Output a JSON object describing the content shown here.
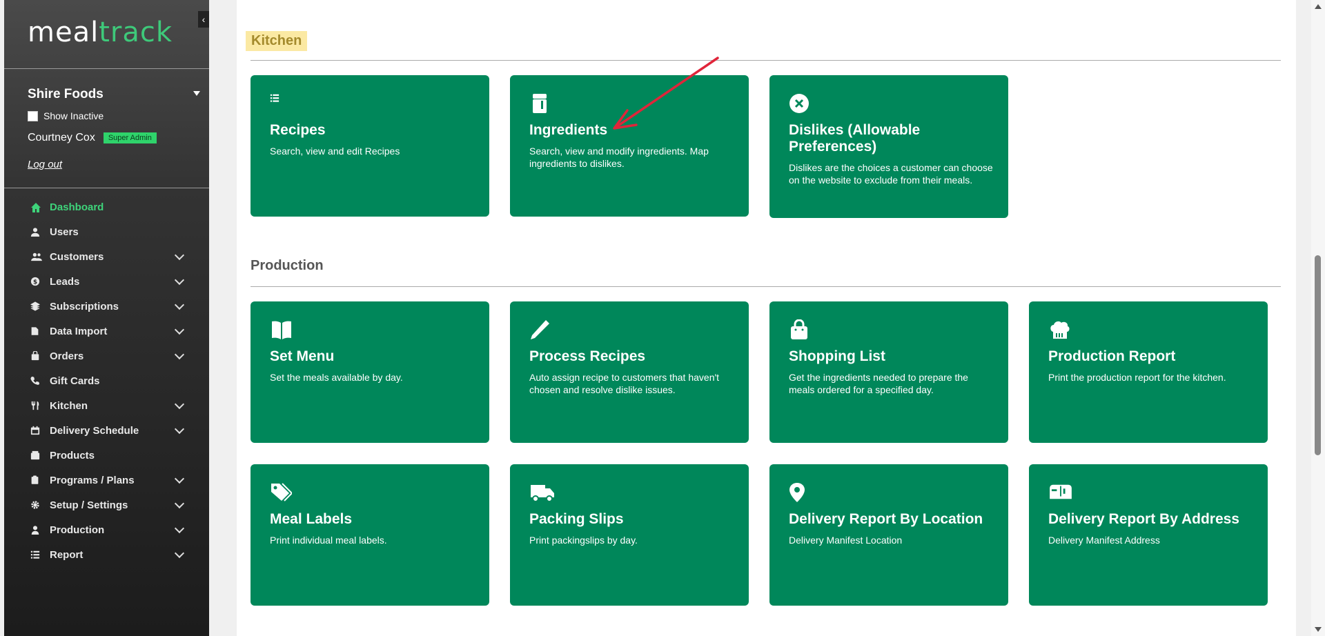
{
  "brand": {
    "logo_part1": "meal",
    "logo_part2": "track"
  },
  "org": {
    "name": "Shire Foods",
    "show_inactive": "Show Inactive"
  },
  "user": {
    "name": "Courtney Cox",
    "role": "Super Admin",
    "logout": "Log out"
  },
  "nav": [
    {
      "label": "Dashboard",
      "icon": "home-icon",
      "expandable": false
    },
    {
      "label": "Users",
      "icon": "user-icon",
      "expandable": false
    },
    {
      "label": "Customers",
      "icon": "users-icon",
      "expandable": true
    },
    {
      "label": "Leads",
      "icon": "dollar-icon",
      "expandable": true
    },
    {
      "label": "Subscriptions",
      "icon": "layers-icon",
      "expandable": true
    },
    {
      "label": "Data Import",
      "icon": "file-icon",
      "expandable": true
    },
    {
      "label": "Orders",
      "icon": "bag-icon",
      "expandable": true
    },
    {
      "label": "Gift Cards",
      "icon": "phone-icon",
      "expandable": false
    },
    {
      "label": "Kitchen",
      "icon": "utensils-icon",
      "expandable": true
    },
    {
      "label": "Delivery Schedule",
      "icon": "calendar-icon",
      "expandable": true
    },
    {
      "label": "Products",
      "icon": "box-icon",
      "expandable": false
    },
    {
      "label": "Programs / Plans",
      "icon": "clipboard-icon",
      "expandable": true
    },
    {
      "label": "Setup / Settings",
      "icon": "gear-icon",
      "expandable": true
    },
    {
      "label": "Production",
      "icon": "person-icon",
      "expandable": true
    },
    {
      "label": "Report",
      "icon": "list-icon",
      "expandable": true
    }
  ],
  "sections": {
    "kitchen": {
      "title": "Kitchen",
      "cards": [
        {
          "title": "Recipes",
          "desc": "Search, view and edit Recipes",
          "icon": "list-icon"
        },
        {
          "title": "Ingredients",
          "desc": "Search, view and modify ingredients. Map ingredients to dislikes.",
          "icon": "ingredient-jar-icon"
        },
        {
          "title": "Dislikes (Allowable Preferences)",
          "desc": "Dislikes are the choices a customer can choose on the website to exclude from their meals.",
          "icon": "x-circle-icon"
        }
      ]
    },
    "production": {
      "title": "Production",
      "cards": [
        {
          "title": "Set Menu",
          "desc": "Set the meals available by day.",
          "icon": "book-icon"
        },
        {
          "title": "Process Recipes",
          "desc": "Auto assign recipe to customers that haven't chosen and resolve dislike issues.",
          "icon": "pen-icon"
        },
        {
          "title": "Shopping List",
          "desc": "Get the ingredients needed to prepare the meals ordered for a specified day.",
          "icon": "shopping-bag-icon"
        },
        {
          "title": "Production Report",
          "desc": "Print the production report for the kitchen.",
          "icon": "chef-hat-icon"
        },
        {
          "title": "Meal Labels",
          "desc": "Print individual meal labels.",
          "icon": "tags-icon"
        },
        {
          "title": "Packing Slips",
          "desc": "Print packingslips by day.",
          "icon": "truck-icon"
        },
        {
          "title": "Delivery Report By Location",
          "desc": "Delivery Manifest Location",
          "icon": "map-pin-icon"
        },
        {
          "title": "Delivery Report By Address",
          "desc": "Delivery Manifest Address",
          "icon": "mailbox-icon"
        }
      ]
    }
  },
  "colors": {
    "card": "#00875a",
    "accent": "#3ec97a",
    "annotation_arrow": "#e0253a"
  }
}
